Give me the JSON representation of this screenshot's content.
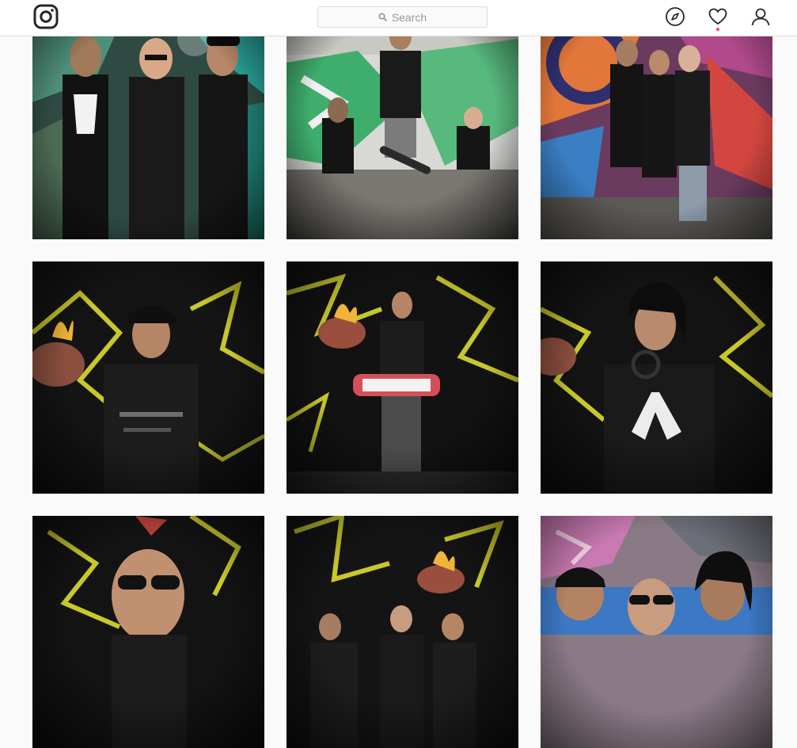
{
  "app": {
    "name": "Instagram"
  },
  "header": {
    "logo_icon": "instagram-logo-icon",
    "search": {
      "placeholder": "Search",
      "icon": "search-icon"
    },
    "nav": [
      {
        "name": "explore",
        "icon": "compass-icon"
      },
      {
        "name": "activity",
        "icon": "heart-icon",
        "has_notification": true
      },
      {
        "name": "profile",
        "icon": "user-icon"
      }
    ],
    "notification_color": "#ed4956"
  },
  "colors": {
    "border": "#dbdbdb",
    "placeholder": "#999999",
    "icon": "#262626",
    "background": "#fafafa"
  },
  "grid": {
    "posts": [
      {
        "scene": "three-men-graffiti-wall-teal"
      },
      {
        "scene": "skateboard-jump-graffiti-wall"
      },
      {
        "scene": "three-men-colorful-mural"
      },
      {
        "scene": "young-man-black-cap-dark-graffiti"
      },
      {
        "scene": "man-holding-skateboard-dark-graffiti"
      },
      {
        "scene": "long-hair-man-headphones-dark-graffiti"
      },
      {
        "scene": "bald-man-sunglasses-dark-graffiti"
      },
      {
        "scene": "group-dark-graffiti-flaming-heart"
      },
      {
        "scene": "three-men-pink-graffiti-wall"
      }
    ]
  }
}
